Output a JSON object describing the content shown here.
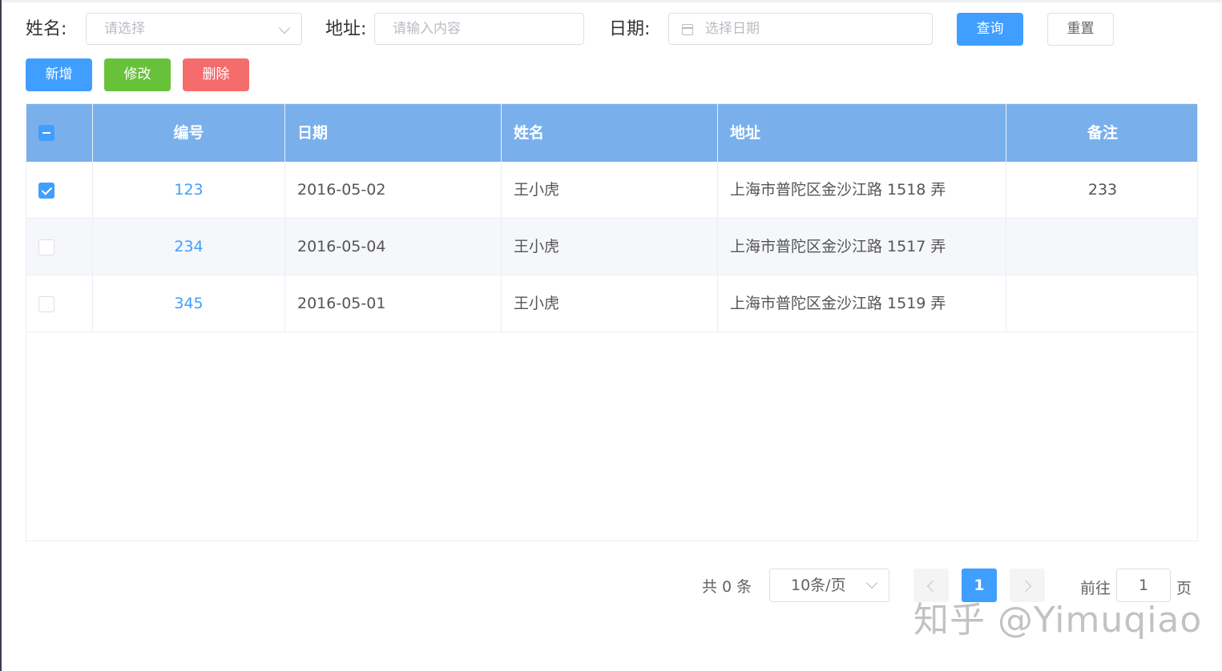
{
  "search": {
    "name_label": "姓名:",
    "name_placeholder": "请选择",
    "address_label": "地址:",
    "address_placeholder": "请输入内容",
    "date_label": "日期:",
    "date_placeholder": "选择日期",
    "query_label": "查询",
    "reset_label": "重置"
  },
  "toolbar": {
    "add_label": "新增",
    "edit_label": "修改",
    "delete_label": "删除"
  },
  "table": {
    "header_color": "#79b0ec",
    "columns": [
      "编号",
      "日期",
      "姓名",
      "地址",
      "备注"
    ],
    "rows": [
      {
        "id": "123",
        "date": "2016-05-02",
        "name": "王小虎",
        "address": "上海市普陀区金沙江路 1518 弄",
        "remark": "233",
        "checked": true
      },
      {
        "id": "234",
        "date": "2016-05-04",
        "name": "王小虎",
        "address": "上海市普陀区金沙江路 1517 弄",
        "remark": "",
        "checked": false
      },
      {
        "id": "345",
        "date": "2016-05-01",
        "name": "王小虎",
        "address": "上海市普陀区金沙江路 1519 弄",
        "remark": "",
        "checked": false
      }
    ]
  },
  "pagination": {
    "total_text": "共 0 条",
    "page_size": "10条/页",
    "current_page": "1",
    "goto_label": "前往",
    "goto_value": "1",
    "page_suffix": "页"
  },
  "watermark": "知乎 @Yimuqiao"
}
